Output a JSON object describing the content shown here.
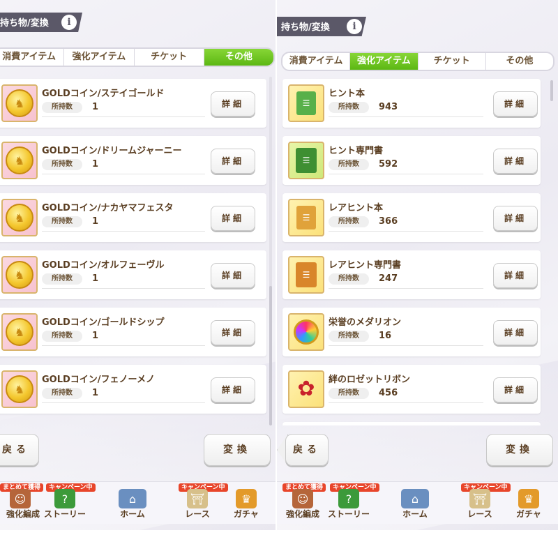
{
  "left": {
    "title": "持ち物/変換",
    "info": "i",
    "tabs": [
      {
        "label": "消費アイテム",
        "active": false
      },
      {
        "label": "強化アイテム",
        "active": false
      },
      {
        "label": "チケット",
        "active": false
      },
      {
        "label": "その他",
        "active": true
      }
    ],
    "qty_label": "所持数",
    "detail_label": "詳細",
    "items": [
      {
        "name": "GOLDコイン/ステイゴールド",
        "qty": "1",
        "icon": "gold-coin-icon"
      },
      {
        "name": "GOLDコイン/ドリームジャーニー",
        "qty": "1",
        "icon": "gold-coin-icon"
      },
      {
        "name": "GOLDコイン/ナカヤマフェスタ",
        "qty": "1",
        "icon": "gold-coin-icon"
      },
      {
        "name": "GOLDコイン/オルフェーヴル",
        "qty": "1",
        "icon": "gold-coin-icon"
      },
      {
        "name": "GOLDコイン/ゴールドシップ",
        "qty": "1",
        "icon": "gold-coin-icon"
      },
      {
        "name": "GOLDコイン/フェノーメノ",
        "qty": "1",
        "icon": "gold-coin-icon"
      }
    ],
    "back_label": "戻る",
    "convert_label": "変換"
  },
  "right": {
    "title": "持ち物/変換",
    "info": "i",
    "tabs": [
      {
        "label": "消費アイテム",
        "active": false
      },
      {
        "label": "強化アイテム",
        "active": true
      },
      {
        "label": "チケット",
        "active": false
      },
      {
        "label": "その他",
        "active": false
      }
    ],
    "qty_label": "所持数",
    "detail_label": "詳細",
    "items": [
      {
        "name": "ヒント本",
        "qty": "943",
        "icon": "hint-book-icon"
      },
      {
        "name": "ヒント専門書",
        "qty": "592",
        "icon": "hint-textbook-icon"
      },
      {
        "name": "レアヒント本",
        "qty": "366",
        "icon": "rare-hint-book-icon"
      },
      {
        "name": "レアヒント専門書",
        "qty": "247",
        "icon": "rare-hint-textbook-icon"
      },
      {
        "name": "栄誉のメダリオン",
        "qty": "16",
        "icon": "medallion-icon"
      },
      {
        "name": "絆のロゼットリボン",
        "qty": "456",
        "icon": "rosette-ribbon-icon"
      }
    ],
    "back_label": "戻る",
    "convert_label": "変換"
  },
  "nav": {
    "items": [
      {
        "label": "強化編成",
        "badge": "まとめて獲得",
        "icon": "character-icon"
      },
      {
        "label": "ストーリー",
        "badge": "キャンペーン中",
        "icon": "story-book-icon"
      },
      {
        "label": "ホーム",
        "badge": "",
        "icon": "home-building-icon"
      },
      {
        "label": "レース",
        "badge": "キャンペーン中",
        "icon": "race-gate-icon"
      },
      {
        "label": "ガチャ",
        "badge": "",
        "icon": "gacha-icon"
      }
    ]
  },
  "colors": {
    "tab_active": "#5cb713",
    "title_bar": "#5b5868",
    "text_brown": "#5a3e22",
    "badge_red": "#e8452a"
  }
}
